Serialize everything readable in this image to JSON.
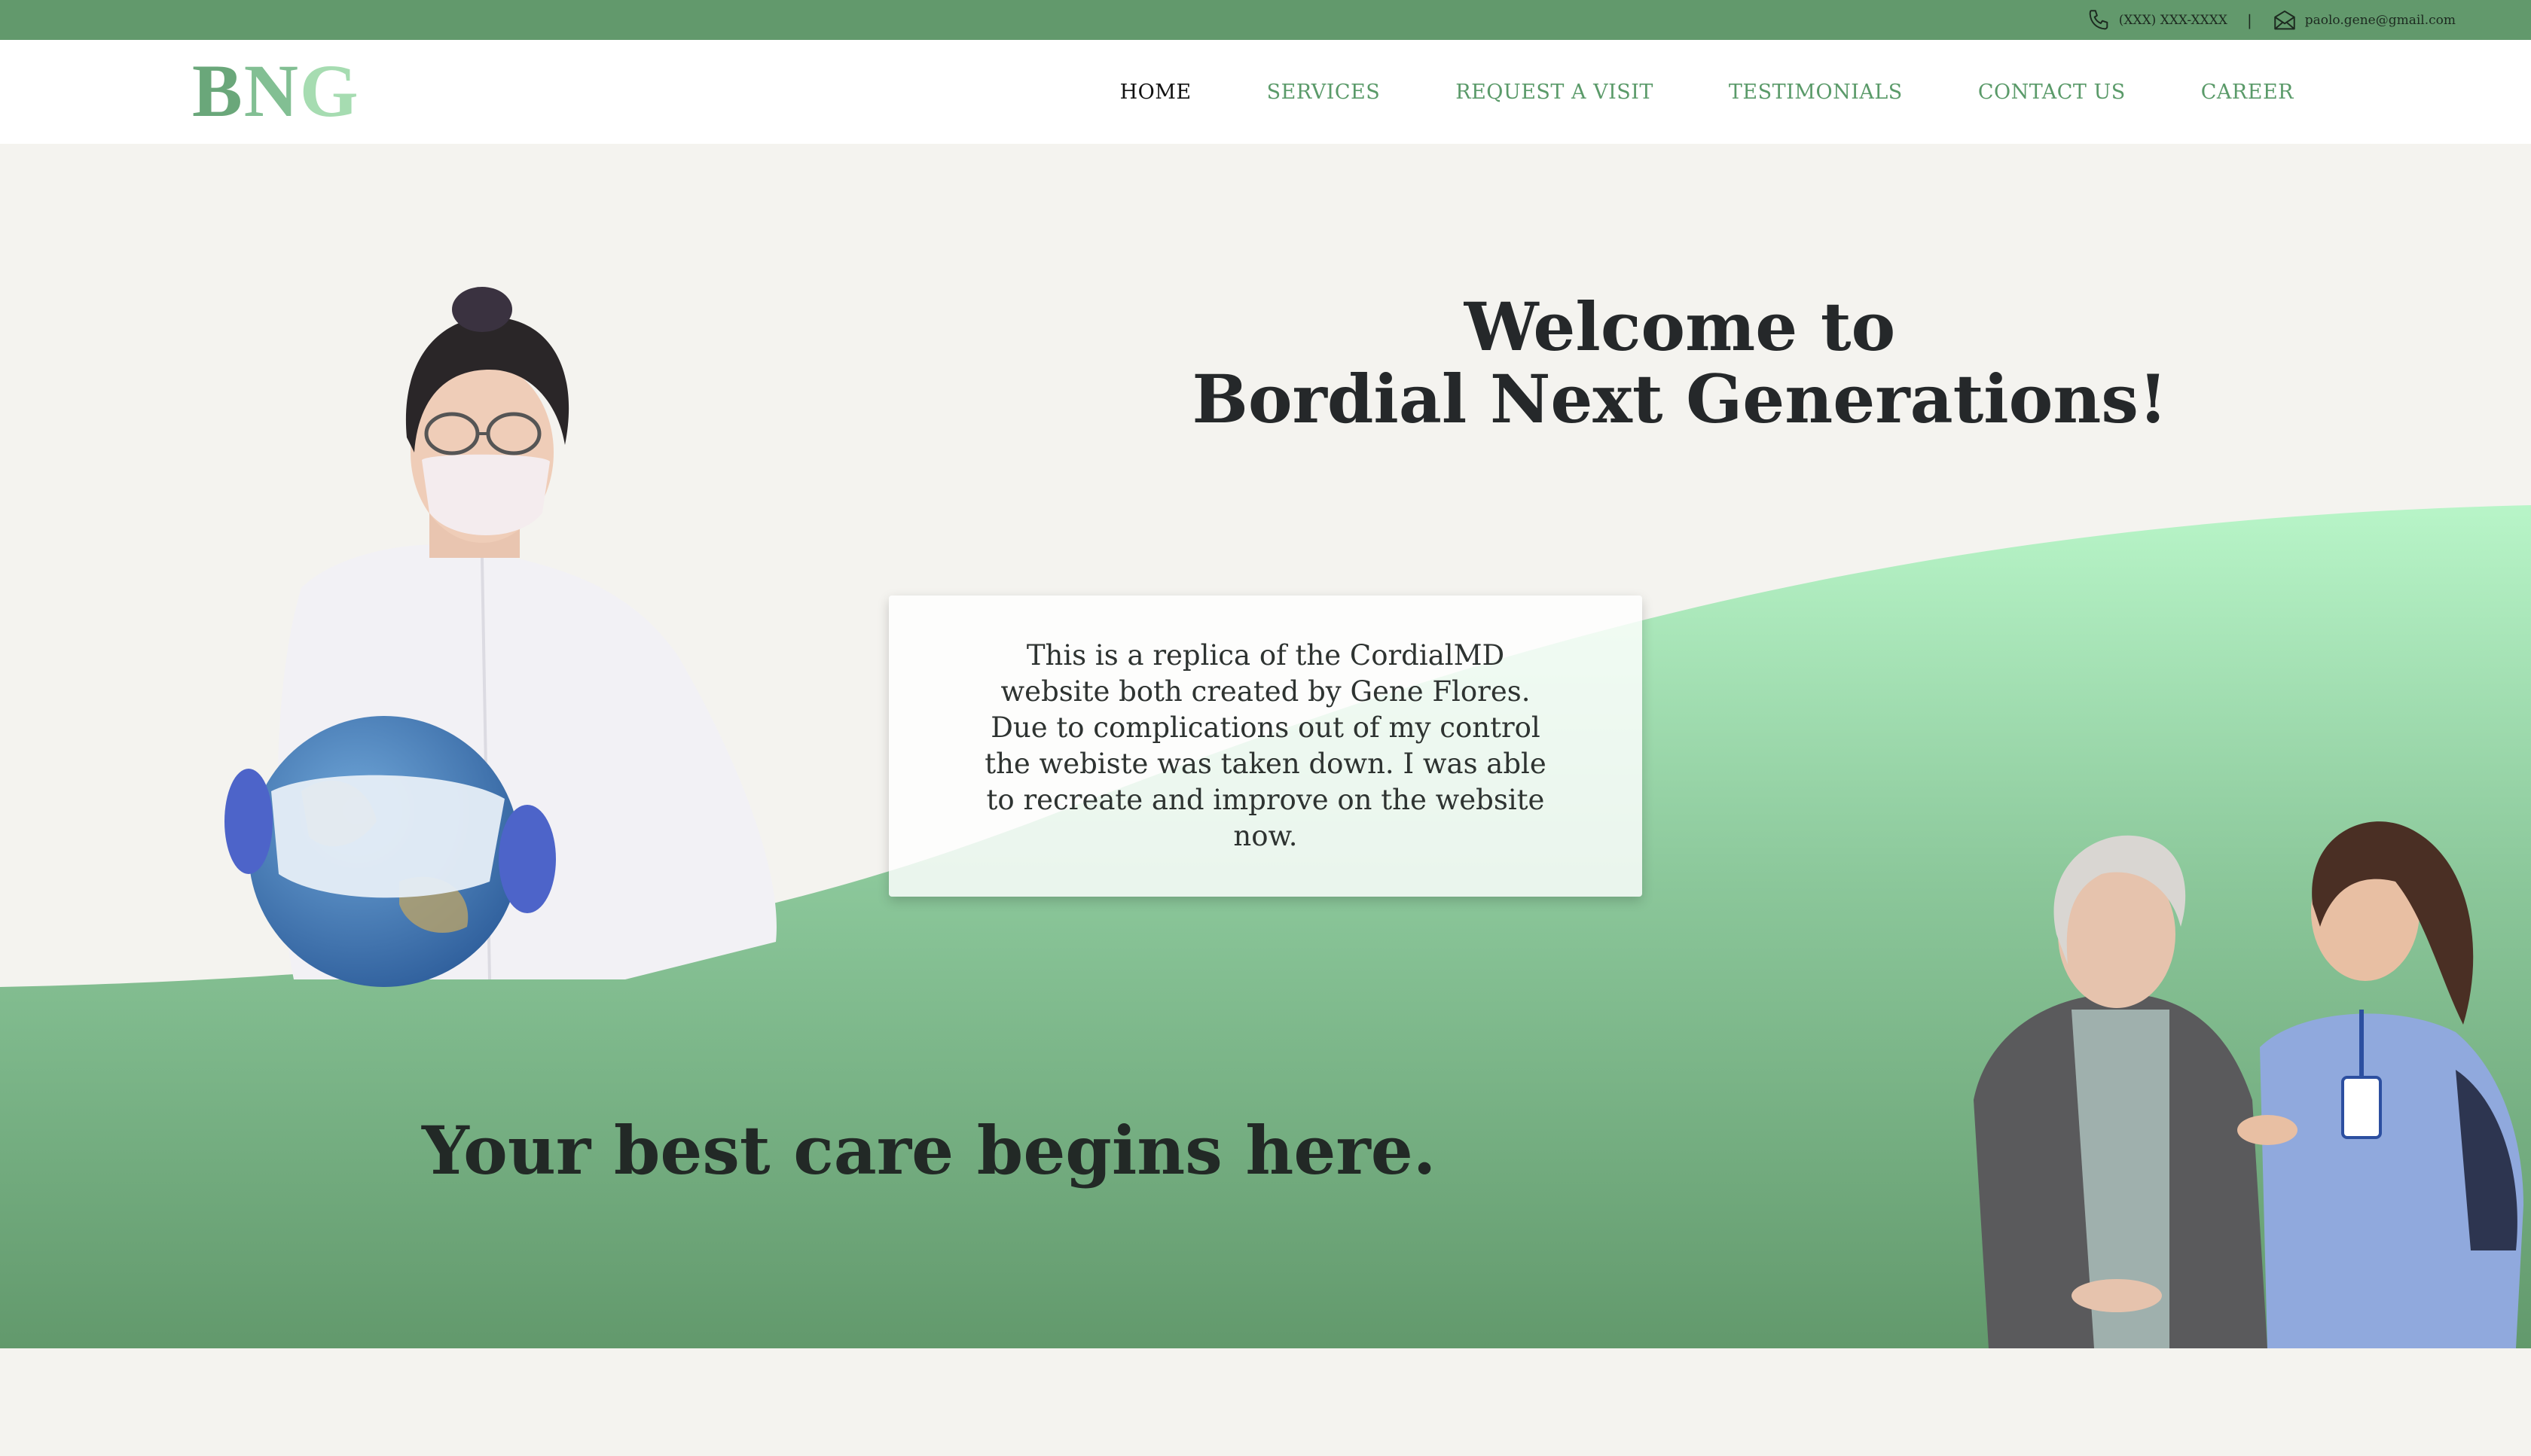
{
  "topbar": {
    "phone": "(XXX) XXX-XXXX",
    "separator": "|",
    "email": "paolo.gene@gmail.com",
    "phone_icon": "phone-icon",
    "email_icon": "envelope-icon"
  },
  "logo": {
    "l1": "B",
    "l2": "N",
    "l3": "G"
  },
  "nav": {
    "items": [
      {
        "label": "HOME"
      },
      {
        "label": "SERVICES"
      },
      {
        "label": "REQUEST A VISIT"
      },
      {
        "label": "TESTIMONIALS"
      },
      {
        "label": "CONTACT US"
      },
      {
        "label": "CAREER"
      }
    ]
  },
  "hero": {
    "welcome_line1": "Welcome to",
    "welcome_line2": "Bordial Next Generations!",
    "card_text": "This is a replica of the CordialMD website both created by Gene Flores. Due to complications out of my control the webiste was taken down. I was able to recreate and improve on the website now.",
    "tagline": "Your best care begins here."
  },
  "colors": {
    "topbar": "#62996c",
    "nav_link": "#5a9a69",
    "nav_active": "#111111",
    "wave_light": "#b8f5c8",
    "wave_dark": "#62996c",
    "background": "#f4f3ef"
  }
}
